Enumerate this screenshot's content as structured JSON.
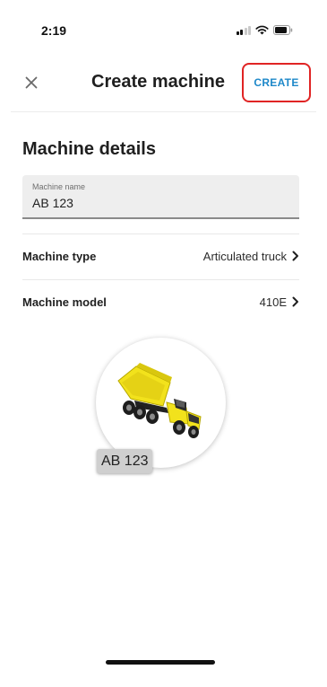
{
  "status_bar": {
    "time": "2:19",
    "icons": [
      "signal-icon",
      "wifi-icon",
      "battery-icon"
    ]
  },
  "header": {
    "title": "Create machine",
    "close_icon": "close-icon",
    "create_label": "CREATE",
    "create_highlight_color": "#e02424",
    "accent_color": "#1e88c9"
  },
  "details": {
    "section_title": "Machine details",
    "name_field": {
      "label": "Machine name",
      "value": "AB 123"
    },
    "rows": [
      {
        "label": "Machine type",
        "value": "Articulated truck",
        "icon": "chevron-right-icon"
      },
      {
        "label": "Machine model",
        "value": "410E",
        "icon": "chevron-right-icon"
      }
    ]
  },
  "preview": {
    "image": "articulated-dump-truck",
    "image_color": "#f2e21c",
    "tag": "AB 123"
  }
}
